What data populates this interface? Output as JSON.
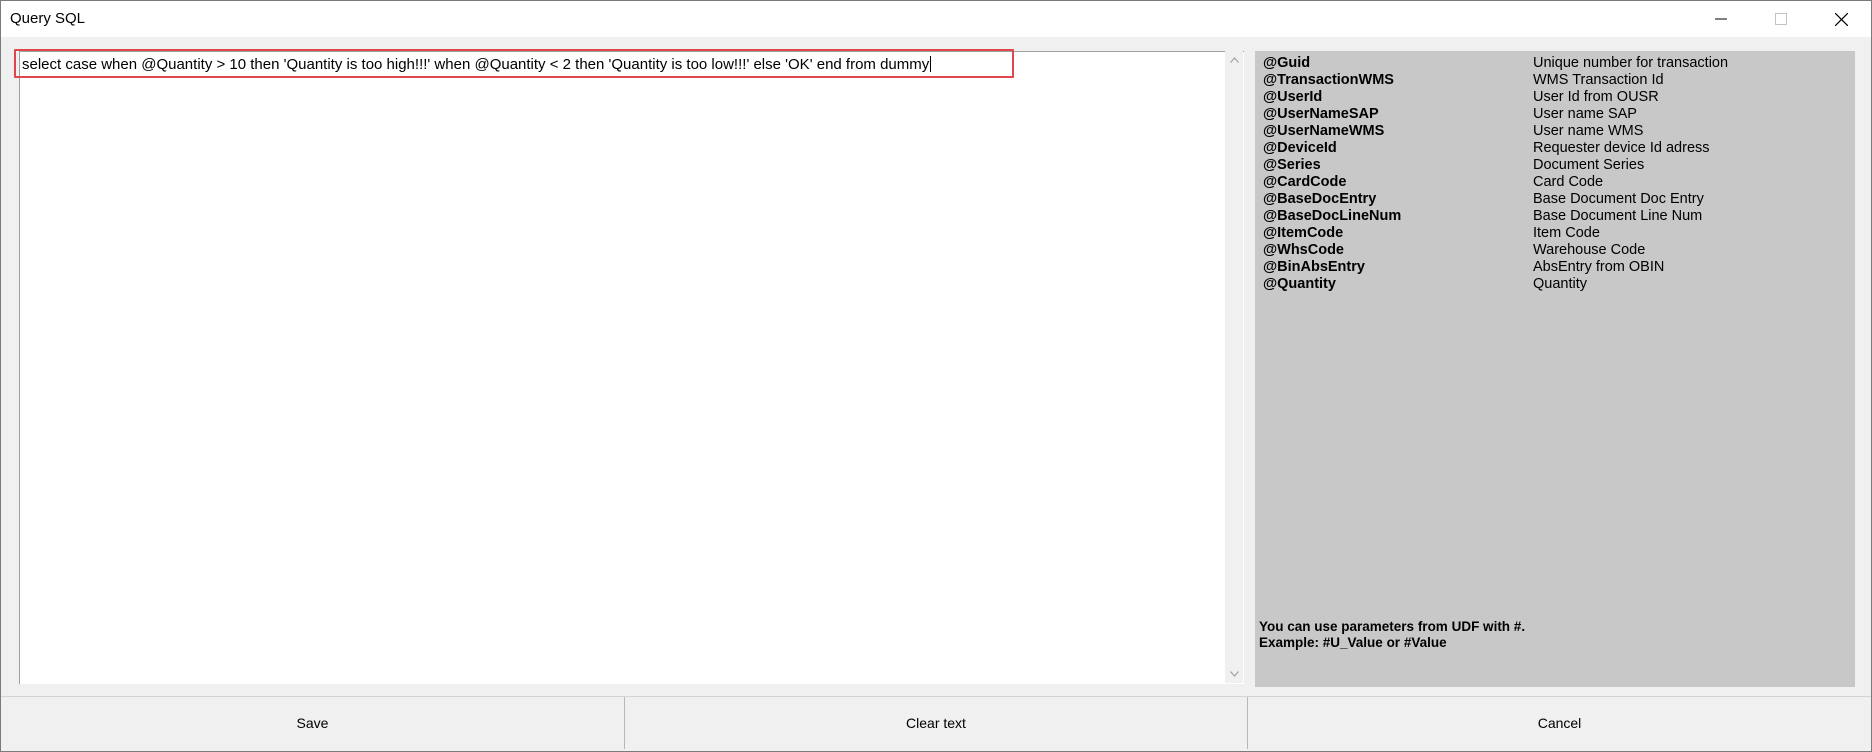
{
  "window": {
    "title": "Query SQL"
  },
  "editor": {
    "value": "select case when @Quantity > 10 then 'Quantity is too high!!!' when @Quantity < 2 then 'Quantity is too low!!!' else 'OK' end from dummy"
  },
  "parameters": [
    {
      "name": "@Guid",
      "description": "Unique number for transaction"
    },
    {
      "name": "@TransactionWMS",
      "description": "WMS Transaction Id"
    },
    {
      "name": "@UserId",
      "description": "User Id from OUSR"
    },
    {
      "name": "@UserNameSAP",
      "description": "User name SAP"
    },
    {
      "name": "@UserNameWMS",
      "description": "User name WMS"
    },
    {
      "name": "@DeviceId",
      "description": "Requester device Id adress"
    },
    {
      "name": "@Series",
      "description": "Document Series"
    },
    {
      "name": "@CardCode",
      "description": "Card Code"
    },
    {
      "name": "@BaseDocEntry",
      "description": "Base Document Doc Entry"
    },
    {
      "name": "@BaseDocLineNum",
      "description": "Base Document Line Num"
    },
    {
      "name": "@ItemCode",
      "description": "Item Code"
    },
    {
      "name": "@WhsCode",
      "description": "Warehouse Code"
    },
    {
      "name": "@BinAbsEntry",
      "description": "AbsEntry from OBIN"
    },
    {
      "name": "@Quantity",
      "description": "Quantity"
    }
  ],
  "help": {
    "line1": "You can use parameters from UDF with #.",
    "line2": "Example: #U_Value or #Value"
  },
  "footer": {
    "save_label": "Save",
    "clear_label": "Clear text",
    "cancel_label": "Cancel"
  },
  "colors": {
    "highlight": "#e0474c",
    "panel": "#c8c8c8"
  }
}
